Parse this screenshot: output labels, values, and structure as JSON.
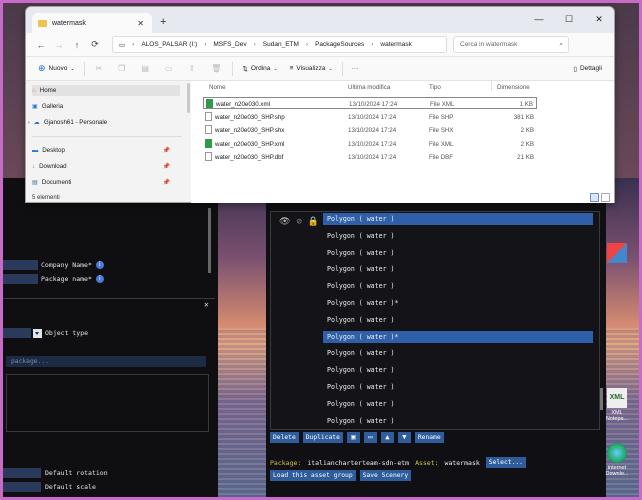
{
  "window": {
    "tab_title": "watermask",
    "tab_close": "✕",
    "new_tab": "+",
    "controls": [
      "—",
      "☐",
      "✕"
    ]
  },
  "address": {
    "nav": [
      "←",
      "→",
      "↑",
      "⟳"
    ],
    "crumbs": [
      "ALOS_PALSAR (I:)",
      "MSFS_Dev",
      "Sudan_ETM",
      "PackageSources",
      "watermask"
    ],
    "search_placeholder": "Cerca in watermask"
  },
  "toolbar": {
    "new_label": "Nuovo",
    "sort_label": "Ordina",
    "view_label": "Visualizza",
    "more_label": "···",
    "details_label": "Dettagli"
  },
  "sidebar": {
    "items": [
      {
        "label": "Home",
        "icon": "home-icon"
      },
      {
        "label": "Galleria",
        "icon": "gallery-icon"
      },
      {
        "label": "Gjanosh61 - Personale",
        "icon": "cloud-icon"
      },
      {
        "label": "Desktop",
        "icon": "desktop-icon"
      },
      {
        "label": "Download",
        "icon": "download-icon"
      },
      {
        "label": "Documenti",
        "icon": "documents-icon"
      }
    ]
  },
  "files": {
    "headers": [
      "Nome",
      "Ultima modifica",
      "Tipo",
      "Dimensione"
    ],
    "rows": [
      {
        "name": "water_n20e030.xml",
        "modified": "13/10/2024 17:24",
        "type": "File XML",
        "size": "1 KB"
      },
      {
        "name": "water_n20e030_SHP.shp",
        "modified": "13/10/2024 17:24",
        "type": "File SHP",
        "size": "381 KB"
      },
      {
        "name": "water_n20e030_SHP.shx",
        "modified": "13/10/2024 17:24",
        "type": "File SHX",
        "size": "2 KB"
      },
      {
        "name": "water_n20e030_SHP.xml",
        "modified": "13/10/2024 17:24",
        "type": "File XML",
        "size": "2 KB"
      },
      {
        "name": "water_n20e030_SHP.dbf",
        "modified": "13/10/2024 17:24",
        "type": "File DBF",
        "size": "21 KB"
      }
    ],
    "status": "5 elementi"
  },
  "leftapp": {
    "company_label": "Company Name*",
    "package_label": "Package name*",
    "info": "i",
    "object_type_label": "Object type",
    "package_placeholder": "package...",
    "close": "✕",
    "default_rotation": "Default rotation",
    "default_scale": "Default scale"
  },
  "polygons": [
    "Polygon  ( water )",
    "Polygon  ( water )",
    "Polygon  ( water )",
    "Polygon  ( water )",
    "Polygon  ( water )",
    "Polygon  ( water )*",
    "Polygon  ( water )",
    "Polygon  ( water )*",
    "Polygon  ( water )",
    "Polygon  ( water )",
    "Polygon  ( water )",
    "Polygon  ( water )",
    "Polygon  ( water )"
  ],
  "actions": {
    "delete": "Delete",
    "duplicate": "Duplicate",
    "up": "▲",
    "down": "▼",
    "rename": "Rename"
  },
  "package_line": {
    "package_label": "Package:",
    "package_value": "italiancharterteam-sdn-etm",
    "asset_label": "Asset:",
    "asset_value": "watermask",
    "select_button": "Select..."
  },
  "bottom_buttons": {
    "load": "Load this asset group",
    "save": "Save Scenery"
  },
  "desktop_icons": [
    {
      "label": "XML\nNotepa...",
      "icon": "xml-notepad-icon"
    },
    {
      "label": "internet\nDownlo...",
      "icon": "internet-download-icon"
    }
  ]
}
